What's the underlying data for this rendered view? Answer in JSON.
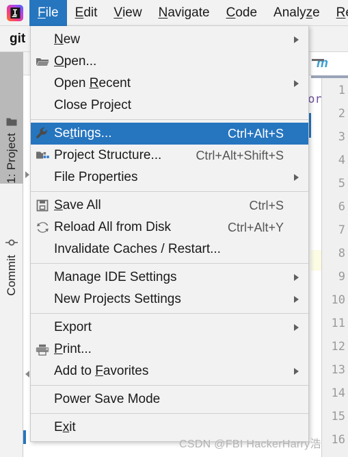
{
  "app": {
    "logo_icon": "intellij-idea-logo",
    "toolbar_label": "git"
  },
  "menubar": {
    "items": [
      {
        "label": "File",
        "mnemonic": "F",
        "active": true
      },
      {
        "label": "Edit",
        "mnemonic": "E",
        "active": false
      },
      {
        "label": "View",
        "mnemonic": "V",
        "active": false
      },
      {
        "label": "Navigate",
        "mnemonic": "N",
        "active": false
      },
      {
        "label": "Code",
        "mnemonic": "C",
        "active": false
      },
      {
        "label": "Analyze",
        "mnemonic": "z",
        "active": false
      },
      {
        "label": "Refac",
        "mnemonic": "R",
        "active": false
      }
    ]
  },
  "file_menu": {
    "rows": [
      {
        "type": "item",
        "label": "New",
        "icon": "",
        "accel": "",
        "submenu": true
      },
      {
        "type": "item",
        "label": "Open...",
        "icon": "folder-open-icon",
        "accel": "",
        "submenu": false
      },
      {
        "type": "item",
        "label": "Open Recent",
        "icon": "",
        "accel": "",
        "submenu": true
      },
      {
        "type": "item",
        "label": "Close Project",
        "icon": "",
        "accel": "",
        "submenu": false
      },
      {
        "type": "separator"
      },
      {
        "type": "item",
        "label": "Settings...",
        "icon": "wrench-icon",
        "accel": "Ctrl+Alt+S",
        "submenu": false,
        "highlight": true
      },
      {
        "type": "item",
        "label": "Project Structure...",
        "icon": "project-structure-icon",
        "accel": "Ctrl+Alt+Shift+S",
        "submenu": false
      },
      {
        "type": "item",
        "label": "File Properties",
        "icon": "",
        "accel": "",
        "submenu": true
      },
      {
        "type": "separator"
      },
      {
        "type": "item",
        "label": "Save All",
        "icon": "save-icon",
        "accel": "Ctrl+S",
        "submenu": false
      },
      {
        "type": "item",
        "label": "Reload All from Disk",
        "icon": "reload-icon",
        "accel": "Ctrl+Alt+Y",
        "submenu": false
      },
      {
        "type": "item",
        "label": "Invalidate Caches / Restart...",
        "icon": "",
        "accel": "",
        "submenu": false
      },
      {
        "type": "separator"
      },
      {
        "type": "item",
        "label": "Manage IDE Settings",
        "icon": "",
        "accel": "",
        "submenu": true
      },
      {
        "type": "item",
        "label": "New Projects Settings",
        "icon": "",
        "accel": "",
        "submenu": true
      },
      {
        "type": "separator"
      },
      {
        "type": "item",
        "label": "Export",
        "icon": "",
        "accel": "",
        "submenu": true
      },
      {
        "type": "item",
        "label": "Print...",
        "icon": "printer-icon",
        "accel": "",
        "submenu": false
      },
      {
        "type": "item",
        "label": "Add to Favorites",
        "icon": "",
        "accel": "",
        "submenu": true
      },
      {
        "type": "separator"
      },
      {
        "type": "item",
        "label": "Power Save Mode",
        "icon": "",
        "accel": "",
        "submenu": false
      },
      {
        "type": "separator"
      },
      {
        "type": "item",
        "label": "Exit",
        "icon": "",
        "accel": "",
        "submenu": false
      }
    ]
  },
  "sidebar": {
    "buttons": [
      {
        "label": "1: Project",
        "icon": "folder-icon",
        "selected": true
      },
      {
        "label": "Commit",
        "icon": "commit-icon",
        "selected": false
      }
    ]
  },
  "editor": {
    "tab_label": "m",
    "code_fragment": "por",
    "line_numbers": [
      "1",
      "2",
      "3",
      "4",
      "5",
      "6",
      "7",
      "8",
      "9",
      "10",
      "11",
      "12",
      "13",
      "14",
      "15",
      "16"
    ]
  },
  "watermark": {
    "text": "CSDN @FBI HackerHarry浩"
  },
  "colors": {
    "accent": "#2675bf",
    "menu_bg": "#f2f2f2",
    "selected_strip": "#b9b9b9",
    "tab_text": "#3b9fd4",
    "highlight_line": "#fcfbe3"
  }
}
